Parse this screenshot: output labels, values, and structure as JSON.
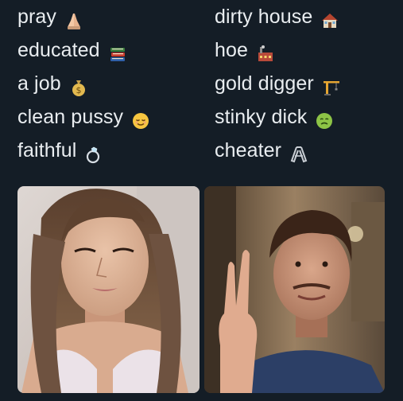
{
  "left_list": [
    {
      "label": "pray",
      "icon": "folded-hands-icon"
    },
    {
      "label": "educated",
      "icon": "books-icon"
    },
    {
      "label": "a job",
      "icon": "money-bag-icon"
    },
    {
      "label": "clean pussy",
      "icon": "relieved-face-icon"
    },
    {
      "label": "faithful",
      "icon": "ring-icon"
    }
  ],
  "right_list": [
    {
      "label": "dirty house",
      "icon": "house-icon"
    },
    {
      "label": "hoe",
      "icon": "factory-icon"
    },
    {
      "label": "gold digger",
      "icon": "construction-crane-icon"
    },
    {
      "label": "stinky dick",
      "icon": "nauseated-face-icon"
    },
    {
      "label": "cheater",
      "icon": "linked-rings-icon"
    }
  ],
  "colors": {
    "background": "#141d26",
    "text": "#e9edf0"
  }
}
